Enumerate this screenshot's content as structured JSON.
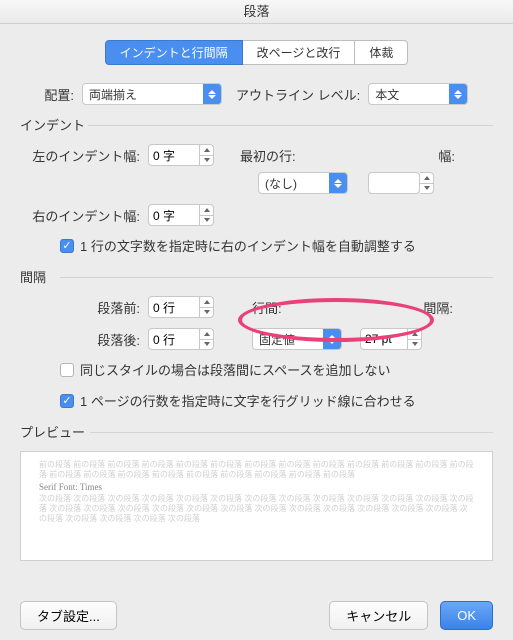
{
  "title": "段落",
  "tabs": {
    "t1": "インデントと行間隔",
    "t2": "改ページと改行",
    "t3": "体裁"
  },
  "alignment": {
    "label": "配置:",
    "value": "両端揃え"
  },
  "outline": {
    "label": "アウトライン レベル:",
    "value": "本文"
  },
  "indent": {
    "group": "インデント",
    "left_label": "左のインデント幅:",
    "left_value": "0 字",
    "right_label": "右のインデント幅:",
    "right_value": "0 字",
    "first_label": "最初の行:",
    "first_value": "(なし)",
    "width_label": "幅:",
    "width_value": "",
    "auto_adjust": "1 行の文字数を指定時に右のインデント幅を自動調整する"
  },
  "spacing": {
    "group": "間隔",
    "before_label": "段落前:",
    "before_value": "0 行",
    "after_label": "段落後:",
    "after_value": "0 行",
    "line_label": "行間:",
    "line_value": "固定値",
    "gap_label": "間隔:",
    "gap_value": "27 pt",
    "same_style": "同じスタイルの場合は段落間にスペースを追加しない",
    "grid": "1 ページの行数を指定時に文字を行グリッド線に合わせる"
  },
  "preview": {
    "label": "プレビュー",
    "grey_before": "前の段落 前の段落 前の段落 前の段落 前の段落 前の段落 前の段落 前の段落 前の段落 前の段落 前の段落 前の段落 前の段落 前の段落 前の段落 前の段落 前の段落 前の段落 前の段落 前の段落 前の段落 前の段落",
    "sample": "Serif Font: Times",
    "grey_after": "次の段落 次の段落 次の段落 次の段落 次の段落 次の段落 次の段落 次の段落 次の段落 次の段落 次の段落 次の段落 次の段落 次の段落 次の段落 次の段落 次の段落 次の段落 次の段落 次の段落 次の段落 次の段落 次の段落 次の段落 次の段落 次の段落 次の段落 次の段落 次の段落 次の段落"
  },
  "buttons": {
    "tabs": "タブ設定...",
    "cancel": "キャンセル",
    "ok": "OK"
  }
}
